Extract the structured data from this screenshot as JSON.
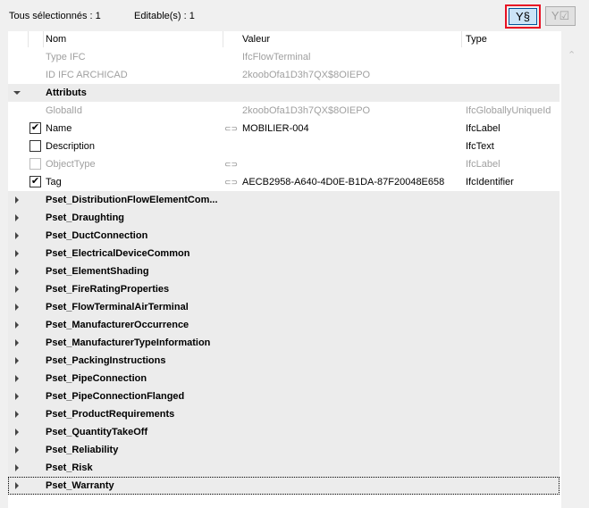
{
  "toolbar": {
    "all_selected": "Tous sélectionnés : 1",
    "editable": "Editable(s) : 1",
    "filter_button_label": "Y§",
    "filter_check_label": "Y☑"
  },
  "columns": {
    "name": "Nom",
    "value": "Valeur",
    "type": "Type"
  },
  "info_rows": [
    {
      "name": "Type IFC",
      "value": "IfcFlowTerminal"
    },
    {
      "name": "ID IFC ARCHICAD",
      "value": "2koobOfa1D3h7QX$8OIEPO"
    }
  ],
  "attributes": {
    "label": "Attributs",
    "rows": [
      {
        "name": "GlobalId",
        "value": "2koobOfa1D3h7QX$8OIEPO",
        "type": "IfcGloballyUniqueId",
        "checkbox": "none",
        "link": false,
        "dim": true
      },
      {
        "name": "Name",
        "value": "MOBILIER-004",
        "type": "IfcLabel",
        "checkbox": "checked",
        "link": true,
        "dim": false
      },
      {
        "name": "Description",
        "value": "",
        "type": "IfcText",
        "checkbox": "unchecked",
        "link": false,
        "dim": false
      },
      {
        "name": "ObjectType",
        "value": "",
        "type": "IfcLabel",
        "checkbox": "disabled",
        "link": true,
        "dim": true
      },
      {
        "name": "Tag",
        "value": "AECB2958-A640-4D0E-B1DA-87F20048E658",
        "type": "IfcIdentifier",
        "checkbox": "checked",
        "link": true,
        "dim": false
      }
    ]
  },
  "psets": [
    "Pset_DistributionFlowElementCom...",
    "Pset_Draughting",
    "Pset_DuctConnection",
    "Pset_ElectricalDeviceCommon",
    "Pset_ElementShading",
    "Pset_FireRatingProperties",
    "Pset_FlowTerminalAirTerminal",
    "Pset_ManufacturerOccurrence",
    "Pset_ManufacturerTypeInformation",
    "Pset_PackingInstructions",
    "Pset_PipeConnection",
    "Pset_PipeConnectionFlanged",
    "Pset_ProductRequirements",
    "Pset_QuantityTakeOff",
    "Pset_Reliability",
    "Pset_Risk",
    "Pset_Warranty"
  ],
  "colors": {
    "highlight": "#e81123",
    "button_active": "#cce4f7",
    "group_bg": "#ececec"
  }
}
